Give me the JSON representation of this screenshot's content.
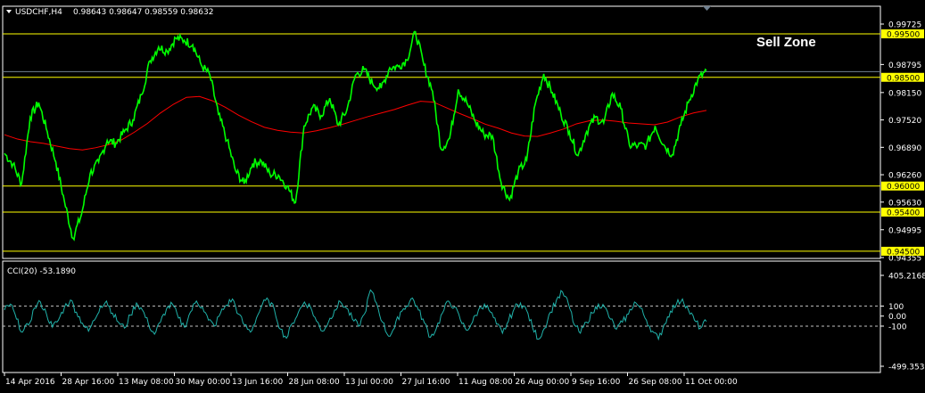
{
  "header": {
    "symbol": "USDCHF,H4",
    "ohlc": "0.98643 0.98647 0.98559 0.98632",
    "indicator": "CCI(20) -53.1890"
  },
  "annotation": "Sell Zone",
  "colors": {
    "background": "#000000",
    "frame": "#ffffff",
    "price": "#00ff00",
    "ma": "#ff0000",
    "level": "#ffff00",
    "cci": "#20b2aa",
    "current_price_line": "#708090"
  },
  "chart_data": [
    {
      "type": "line",
      "title": "USDCHF,H4",
      "ylim": [
        0.94355,
        0.99725
      ],
      "y_ticks": [
        "0.99725",
        "0.98795",
        "0.98150",
        "0.97520",
        "0.96890",
        "0.96260",
        "0.95630",
        "0.94995",
        "0.94355"
      ],
      "y_ticks_values": [
        0.99725,
        0.98795,
        0.9815,
        0.9752,
        0.9689,
        0.9626,
        0.9563,
        0.94995,
        0.94355
      ],
      "current_price": "0.98632",
      "levels": [
        {
          "label": "0.99500",
          "value": 0.995
        },
        {
          "label": "0.98500",
          "value": 0.985
        },
        {
          "label": "0.96000",
          "value": 0.96
        },
        {
          "label": "0.95400",
          "value": 0.954
        },
        {
          "label": "0.94500",
          "value": 0.945
        }
      ],
      "x_labels": [
        "14 Apr 2016",
        "28 Apr 16:00",
        "13 May 08:00",
        "30 May 00:00",
        "13 Jun 16:00",
        "28 Jun 08:00",
        "13 Jul 00:00",
        "27 Jul 16:00",
        "11 Aug 08:00",
        "26 Aug 00:00",
        "9 Sep 16:00",
        "26 Sep 08:00",
        "11 Oct 00:00"
      ],
      "series": [
        {
          "name": "USDCHF",
          "values": [
            0.9675,
            0.965,
            0.9605,
            0.9758,
            0.9792,
            0.9725,
            0.9655,
            0.9565,
            0.948,
            0.9535,
            0.9628,
            0.9655,
            0.9705,
            0.9698,
            0.9725,
            0.9752,
            0.981,
            0.9888,
            0.992,
            0.991,
            0.994,
            0.9935,
            0.9925,
            0.9878,
            0.9855,
            0.9765,
            0.9705,
            0.9635,
            0.9605,
            0.9652,
            0.9658,
            0.9628,
            0.9625,
            0.96,
            0.9562,
            0.9738,
            0.9781,
            0.9762,
            0.9802,
            0.974,
            0.9775,
            0.9855,
            0.9868,
            0.9835,
            0.9825,
            0.9872,
            0.9875,
            0.989,
            0.9955,
            0.9878,
            0.9818,
            0.9685,
            0.971,
            0.9822,
            0.9792,
            0.9748,
            0.9719,
            0.9715,
            0.9609,
            0.9568,
            0.9632,
            0.966,
            0.9788,
            0.9858,
            0.9815,
            0.9766,
            0.9725,
            0.967,
            0.9725,
            0.9758,
            0.9745,
            0.9813,
            0.9778,
            0.9694,
            0.9692,
            0.9694,
            0.9738,
            0.9695,
            0.9672,
            0.974,
            0.9798,
            0.9845,
            0.9865
          ]
        },
        {
          "name": "MA",
          "values": [
            0.9718,
            0.9708,
            0.9702,
            0.9698,
            0.9692,
            0.9686,
            0.9683,
            0.9688,
            0.9695,
            0.9706,
            0.9724,
            0.9744,
            0.9768,
            0.9788,
            0.9804,
            0.9806,
            0.9796,
            0.9781,
            0.9763,
            0.9748,
            0.9735,
            0.9728,
            0.9724,
            0.9722,
            0.9727,
            0.9734,
            0.9742,
            0.9751,
            0.976,
            0.9768,
            0.9776,
            0.9786,
            0.9795,
            0.9793,
            0.978,
            0.9767,
            0.9755,
            0.9742,
            0.9733,
            0.9722,
            0.9715,
            0.9714,
            0.9722,
            0.9731,
            0.9743,
            0.975,
            0.9752,
            0.9749,
            0.9745,
            0.9743,
            0.9741,
            0.9747,
            0.9759,
            0.9768,
            0.9774
          ]
        }
      ]
    },
    {
      "type": "line",
      "title": "CCI(20) -53.1890",
      "ylim": [
        -499.3537,
        405.2168
      ],
      "y_ticks": [
        "405.2168",
        "100",
        "0.00",
        "-100",
        "-499.3537"
      ],
      "y_ticks_values": [
        405.2168,
        100,
        0,
        -100,
        -499.3537
      ],
      "levels": [
        100,
        -100
      ],
      "series": [
        {
          "name": "CCI(20)",
          "values": [
            60,
            120,
            -30,
            -160,
            -90,
            80,
            140,
            20,
            -110,
            -40,
            90,
            160,
            40,
            -70,
            -150,
            -40,
            100,
            150,
            30,
            -60,
            -120,
            10,
            130,
            60,
            -80,
            -180,
            -60,
            70,
            120,
            -20,
            -110,
            40,
            150,
            90,
            -40,
            -100,
            30,
            110,
            170,
            20,
            -90,
            -160,
            -20,
            120,
            160,
            60,
            -130,
            -220,
            -70,
            40,
            140,
            90,
            -50,
            -150,
            -60,
            60,
            140,
            80,
            -30,
            -100,
            20,
            260,
            130,
            -60,
            -200,
            -120,
            40,
            100,
            180,
            60,
            -70,
            -210,
            -120,
            30,
            150,
            90,
            -40,
            -140,
            -60,
            60,
            120,
            40,
            -80,
            -170,
            -50,
            80,
            130,
            60,
            -110,
            -230,
            -120,
            40,
            160,
            240,
            120,
            -90,
            -170,
            -60,
            30,
            120,
            90,
            -30,
            -130,
            -60,
            20,
            140,
            80,
            -40,
            -150,
            -230,
            -80,
            50,
            120,
            170,
            60,
            -40,
            -120,
            -53
          ]
        }
      ]
    }
  ]
}
